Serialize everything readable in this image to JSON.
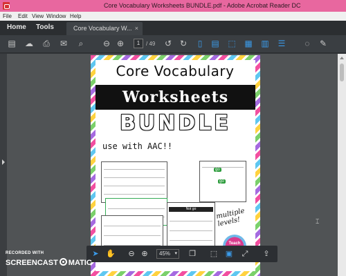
{
  "window": {
    "title": "Core Vocabulary Worksheets BUNDLE.pdf - Adobe Acrobat Reader DC"
  },
  "menu": [
    "File",
    "Edit",
    "View",
    "Window",
    "Help"
  ],
  "tabs": {
    "home": "Home",
    "tools": "Tools",
    "document": "Core Vocabulary W...",
    "close": "×"
  },
  "toolbar": {
    "current_page": "1",
    "total_pages": "/ 49",
    "icons": [
      "save-icon",
      "upload-icon",
      "print-icon",
      "email-icon",
      "search-icon",
      "prev-page-icon",
      "next-page-icon",
      "rotate-left-icon",
      "rotate-right-icon",
      "page-layout-icon",
      "scrolling-icon",
      "select-icon",
      "cut-icon",
      "highlight-icon",
      "comment-icon",
      "sign-icon"
    ]
  },
  "document": {
    "title_line": "Core Vocabulary",
    "band": "Worksheets",
    "bundle": "BUNDLE",
    "aac": "use with AAC!!",
    "go_words": [
      "go",
      "Not go",
      "go"
    ],
    "multiple_levels": "multiple levels!",
    "logo": "Teach"
  },
  "floating_toolbar": {
    "zoom": "45%",
    "icons": [
      "select-arrow-icon",
      "hand-icon",
      "zoom-out-icon",
      "zoom-in-icon",
      "copy-icon",
      "fit-page-icon",
      "fit-width-icon",
      "fullscreen-icon",
      "export-icon"
    ]
  },
  "watermark": {
    "recorded_with": "RECORDED WITH",
    "brand_left": "SCREENCAST",
    "brand_right": "MATIC"
  },
  "colors": {
    "titlebar": "#e8679f",
    "toolbar": "#3a3e42",
    "accent": "#3b9bea"
  }
}
